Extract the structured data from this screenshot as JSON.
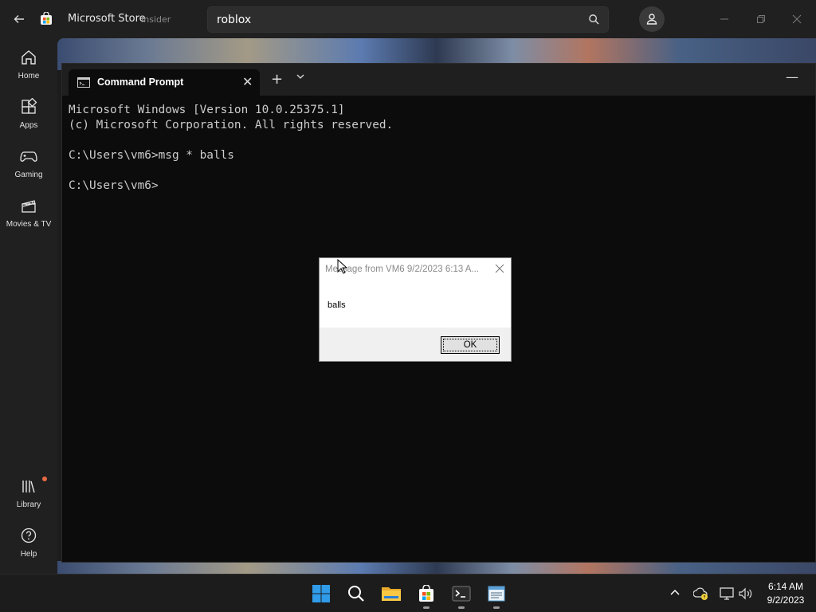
{
  "store": {
    "title": "Microsoft Store",
    "badge": "Insider",
    "search_value": "roblox",
    "nav": [
      {
        "label": "Home",
        "icon": "home-icon"
      },
      {
        "label": "Apps",
        "icon": "apps-icon"
      },
      {
        "label": "Gaming",
        "icon": "gaming-icon"
      },
      {
        "label": "Movies & TV",
        "icon": "movies-icon"
      },
      {
        "label": "Library",
        "icon": "library-icon"
      },
      {
        "label": "Help",
        "icon": "help-icon"
      }
    ]
  },
  "terminal": {
    "tab_title": "Command Prompt",
    "lines": [
      "Microsoft Windows [Version 10.0.25375.1]",
      "(c) Microsoft Corporation. All rights reserved.",
      "",
      "C:\\Users\\vm6>msg * balls",
      "",
      "C:\\Users\\vm6>"
    ]
  },
  "dialog": {
    "title": "Message from VM6 9/2/2023 6:13 A...",
    "message": "balls",
    "ok_label": "OK"
  },
  "taskbar": {
    "apps": [
      "start-icon",
      "search-icon",
      "file-explorer-icon",
      "store-icon",
      "terminal-icon",
      "notepad-icon"
    ],
    "time": "6:14 AM",
    "date": "9/2/2023"
  },
  "colors": {
    "terminal_bg": "#0c0c0c",
    "terminal_text": "#cccccc",
    "library_badge": "#e86a42",
    "start_blue": "#2f9be9"
  }
}
